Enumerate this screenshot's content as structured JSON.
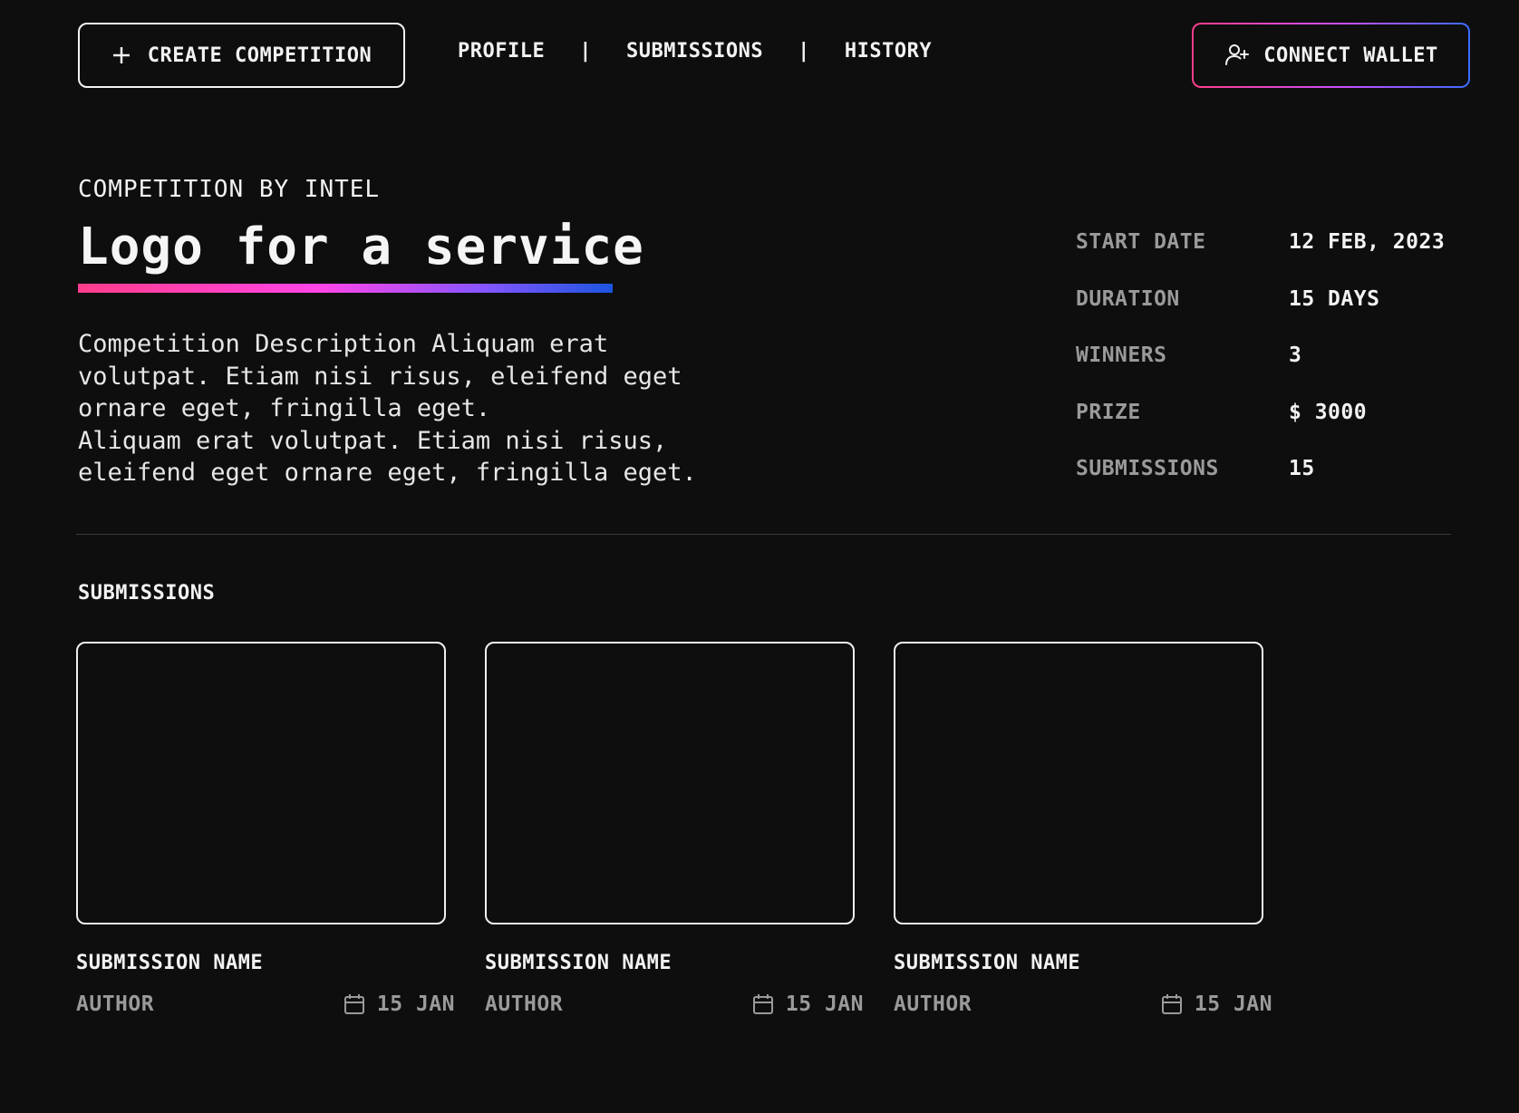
{
  "header": {
    "create_label": "CREATE COMPETITION",
    "nav": [
      "PROFILE",
      "SUBMISSIONS",
      "HISTORY"
    ],
    "nav_separator": "|",
    "wallet_label": "CONNECT WALLET"
  },
  "competition": {
    "by_line": "COMPETITION BY INTEL",
    "title": "Logo for a service",
    "description": "Competition Description Aliquam erat\nvolutpat. Etiam nisi risus, eleifend eget\nornare eget, fringilla eget.\nAliquam erat volutpat. Etiam nisi risus,\neleifend eget ornare eget, fringilla eget."
  },
  "stats": [
    {
      "label": "START DATE",
      "value": "12 FEB, 2023"
    },
    {
      "label": "DURATION",
      "value": "15 DAYS"
    },
    {
      "label": "WINNERS",
      "value": "3"
    },
    {
      "label": "PRIZE",
      "value": "$ 3000"
    },
    {
      "label": "SUBMISSIONS",
      "value": "15"
    }
  ],
  "submissions": {
    "title": "SUBMISSIONS",
    "items": [
      {
        "name": "SUBMISSION NAME",
        "author": "AUTHOR",
        "date": "15 JAN"
      },
      {
        "name": "SUBMISSION NAME",
        "author": "AUTHOR",
        "date": "15 JAN"
      },
      {
        "name": "SUBMISSION NAME",
        "author": "AUTHOR",
        "date": "15 JAN"
      }
    ]
  },
  "colors": {
    "background": "#0e0e0e",
    "text": "#f2f2f2",
    "muted": "#9a9a9a",
    "gradient_start": "#ff3d8b",
    "gradient_mid": "#ff45e6",
    "gradient_end": "#1c55e0"
  },
  "icons": {
    "create": "plus-icon",
    "wallet": "user-plus-icon",
    "date": "calendar-icon"
  }
}
